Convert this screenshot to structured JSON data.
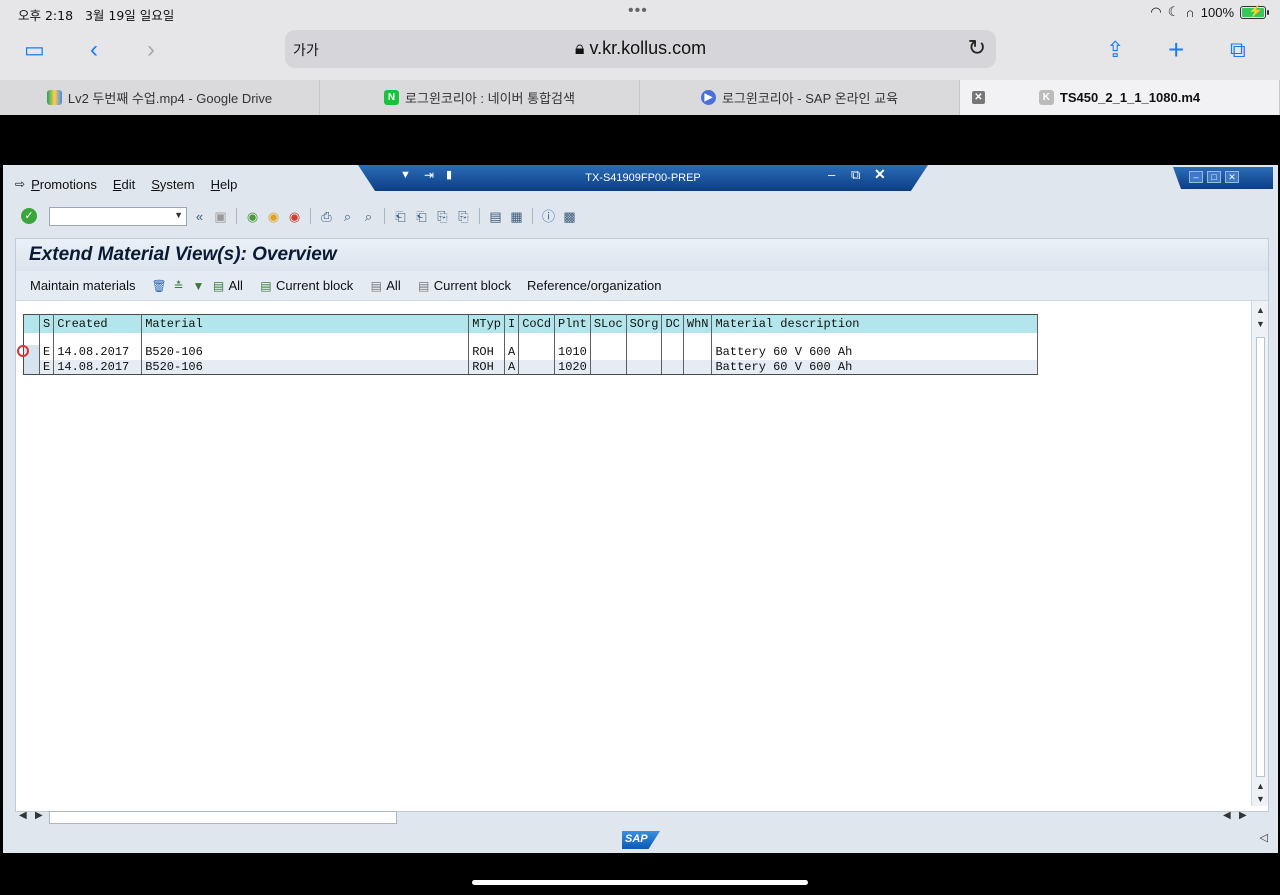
{
  "status": {
    "time": "오후 2:18",
    "date": "3월 19일 일요일",
    "battery_pct": "100%"
  },
  "safari": {
    "url_aa": "가가",
    "url": "v.kr.kollus.com"
  },
  "tabs": [
    {
      "label": "Lv2 두번째 수업.mp4 - Google Drive"
    },
    {
      "label": "로그윈코리아 : 네이버 통합검색"
    },
    {
      "label": "로그윈코리아 - SAP 온라인 교육"
    },
    {
      "label": "TS450_2_1_1_1080.m4"
    }
  ],
  "sap": {
    "system_title": "TX-S41909FP00-PREP",
    "menu": [
      "Promotions",
      "Edit",
      "System",
      "Help"
    ],
    "page_title": "Extend Material View(s): Overview",
    "app_toolbar": {
      "maintain": "Maintain materials",
      "all1": "All",
      "current_block1": "Current block",
      "all2": "All",
      "current_block2": "Current block",
      "reference": "Reference/organization"
    },
    "columns": [
      "S",
      "Created",
      "Material",
      "MTyp",
      "I",
      "CoCd",
      "Plnt",
      "SLoc",
      "SOrg",
      "DC",
      "WhN",
      "Material description"
    ],
    "rows": [
      {
        "s": "E",
        "created": "14.08.2017",
        "material": "B520-106",
        "mtyp": "ROH",
        "i": "A",
        "cocd": "",
        "plnt": "1010",
        "sloc": "",
        "sorg": "",
        "dc": "",
        "whn": "",
        "desc": "Battery 60 V 600 Ah"
      },
      {
        "s": "E",
        "created": "14.08.2017",
        "material": "B520-106",
        "mtyp": "ROH",
        "i": "A",
        "cocd": "",
        "plnt": "1020",
        "sloc": "",
        "sorg": "",
        "dc": "",
        "whn": "",
        "desc": "Battery 60 V 600 Ah"
      }
    ],
    "logo": "SAP"
  }
}
